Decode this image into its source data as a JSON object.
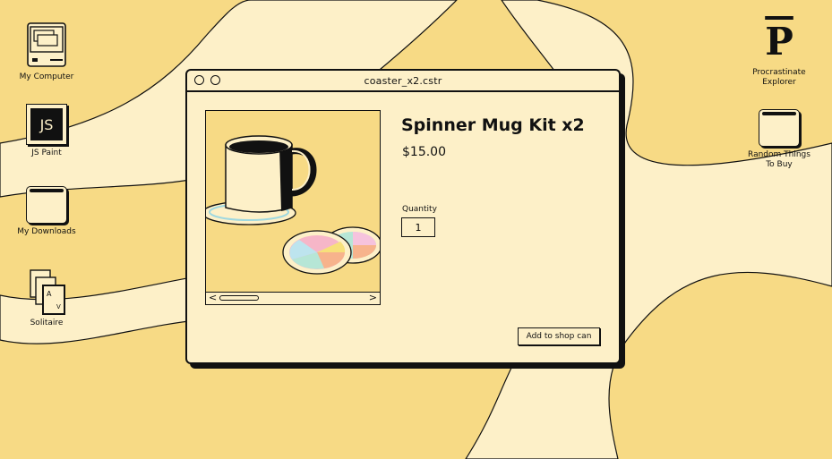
{
  "desktop": {
    "icons_left": [
      {
        "label": "My Computer",
        "icon": "computer-icon"
      },
      {
        "label": "JS Paint",
        "icon": "js-paint-icon",
        "glyph_text": "JS"
      },
      {
        "label": "My Downloads",
        "icon": "folder-icon"
      },
      {
        "label": "Solitaire",
        "icon": "cards-icon",
        "card_top": "A",
        "card_bottom": "V"
      }
    ],
    "icons_right": [
      {
        "label_line1": "Procrastinate",
        "label_line2": "Explorer",
        "icon": "procrastinate-explorer-icon",
        "glyph_text": "P"
      },
      {
        "label_line1": "Random Things",
        "label_line2": "To Buy",
        "icon": "folder-icon"
      }
    ]
  },
  "window": {
    "title": "coaster_x2.cstr",
    "product": {
      "name": "Spinner Mug Kit x2",
      "price": "$15.00",
      "quantity_label": "Quantity",
      "quantity_value": "1",
      "add_button": "Add to shop can"
    },
    "image_scroll": {
      "left_arrow": "<",
      "right_arrow": ">"
    }
  },
  "colors": {
    "background": "#f7da85",
    "panel": "#fdf0c8",
    "ink": "#111111"
  }
}
